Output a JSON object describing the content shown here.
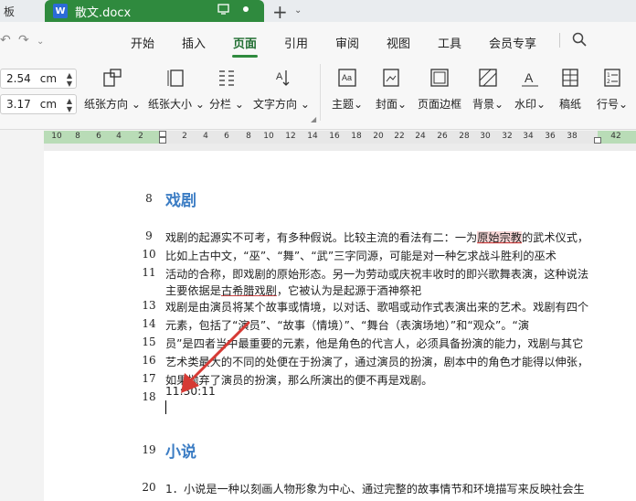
{
  "titlebar": {
    "prev_tab": "板",
    "doc_icon": "W",
    "doc_title": "散文.docx",
    "monitor_icon": "monitor-icon",
    "dot_icon": "dot-icon"
  },
  "menu": {
    "items": [
      "开始",
      "插入",
      "页面",
      "引用",
      "审阅",
      "视图",
      "工具",
      "会员专享"
    ],
    "active": "页面"
  },
  "toolbar": {
    "margin_top": {
      "value": "2.54",
      "unit": "cm"
    },
    "margin_bottom": {
      "value": "3.17",
      "unit": "cm"
    },
    "buttons": [
      {
        "label": "纸张方向",
        "icon": "orientation-icon"
      },
      {
        "label": "纸张大小",
        "icon": "paper-size-icon"
      },
      {
        "label": "分栏",
        "icon": "columns-icon"
      },
      {
        "label": "文字方向",
        "icon": "text-direction-icon"
      },
      {
        "label": "主题",
        "icon": "theme-icon"
      },
      {
        "label": "封面",
        "icon": "cover-icon"
      },
      {
        "label": "页面边框",
        "icon": "page-border-icon"
      },
      {
        "label": "背景",
        "icon": "background-icon"
      },
      {
        "label": "水印",
        "icon": "watermark-icon"
      },
      {
        "label": "稿纸",
        "icon": "manuscript-icon"
      },
      {
        "label": "行号",
        "icon": "line-number-icon"
      }
    ]
  },
  "ruler": {
    "ticks": [
      "10",
      "8",
      "6",
      "4",
      "2",
      "2",
      "4",
      "6",
      "8",
      "10",
      "12",
      "14",
      "16",
      "18",
      "20",
      "22",
      "24",
      "26",
      "28",
      "30",
      "32",
      "34",
      "36",
      "38",
      "42"
    ]
  },
  "document": {
    "heading1": {
      "num": "8",
      "text": "戏剧"
    },
    "lines": [
      {
        "num": "9",
        "parts": [
          "戏剧的起源实不可考，有多种假说。比较主流的看法有二：一为",
          "原始宗教",
          "的武术仪式，"
        ]
      },
      {
        "num": "10",
        "text": "比如上古中文，“巫”、“舞”、“武”三字同源，可能是对一种乞求战斗胜利的巫术"
      },
      {
        "num": "11",
        "text": "活动的合称，即戏剧的原始形态。另一为劳动或庆祝丰收时的即兴歌舞表演，这种说法"
      },
      {
        "num": "",
        "parts": [
          "主要依据是",
          "古希腊戏剧",
          "，它被认为是起源于酒神祭祀"
        ]
      },
      {
        "num": "13",
        "text": "戏剧是由演员将某个故事或情境，以对话、歌唱或动作式表演出来的艺术。戏剧有四个"
      },
      {
        "num": "14",
        "text": "元素，包括了“演员”、“故事（情境）”、“舞台（表演场地）”和“观众”。“演"
      },
      {
        "num": "15",
        "text": "员”是四者当中最重要的元素，他是角色的代言人，必须具备扮演的能力，戏剧与其它"
      },
      {
        "num": "16",
        "text": "艺术类最大的不同的处便在于扮演了，通过演员的扮演，剧本中的角色才能得以伸张，"
      },
      {
        "num": "17",
        "text": "如果抛弃了演员的扮演，那么所演出的便不再是戏剧。"
      },
      {
        "num": "18",
        "text": "11:30:11"
      }
    ],
    "heading2": {
      "num": "19",
      "text": "小说"
    },
    "last": {
      "num": "20",
      "text": "1．小说是一种以刻画人物形象为中心、通过完整的故事情节和环境描写来反映社会生"
    }
  },
  "colors": {
    "accent": "#2f8a3e",
    "heading": "#3c7dc4",
    "annotation_arrow": "#d63a34"
  }
}
